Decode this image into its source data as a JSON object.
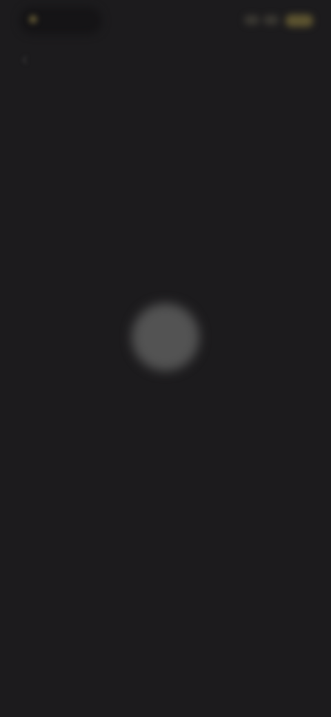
{
  "status_bar": {
    "time": "",
    "accent_color": "#5d5430"
  },
  "header": {
    "title": "",
    "back_icon": "chevron-left-icon"
  },
  "empty_state": {
    "icon": "placeholder-icon",
    "title": "",
    "message": ""
  },
  "colors": {
    "background": "#1c1b1d",
    "title_text": "#cfcfcf",
    "secondary_text": "#6a6a6a"
  }
}
